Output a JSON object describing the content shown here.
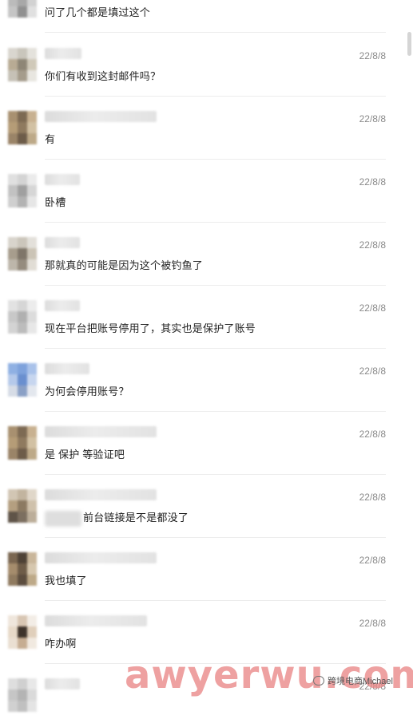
{
  "messages": [
    {
      "text": "问了几个都是填过这个",
      "time": ""
    },
    {
      "text": "你们有收到这封邮件吗？",
      "time": "22/8/8"
    },
    {
      "text": "有",
      "time": "22/8/8"
    },
    {
      "text": "卧槽",
      "time": "22/8/8"
    },
    {
      "text": "那就真的可能是因为这个被钓鱼了",
      "time": "22/8/8"
    },
    {
      "text": "现在平台把账号停用了，其实也是保护了账号",
      "time": "22/8/8"
    },
    {
      "text": "为何会停用账号？",
      "time": "22/8/8"
    },
    {
      "text": "是 保护 等验证吧",
      "time": "22/8/8"
    },
    {
      "text": "前台链接是不是都没了",
      "time": "22/8/8"
    },
    {
      "text": "我也填了",
      "time": "22/8/8"
    },
    {
      "text": "咋办啊",
      "time": "22/8/8"
    },
    {
      "text": "",
      "time": "22/8/8"
    }
  ],
  "watermark": {
    "text": "awyerwu.com",
    "badge": "跨境电商Michael"
  }
}
